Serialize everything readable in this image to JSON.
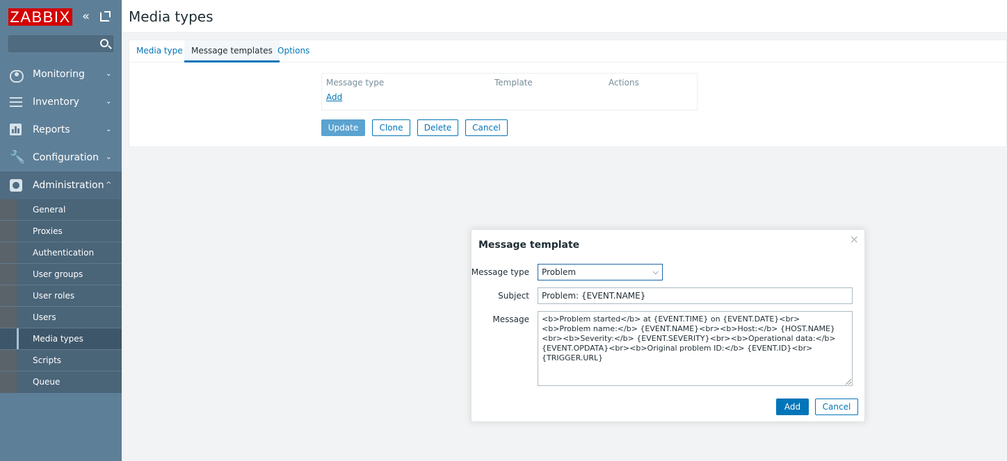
{
  "sidebar": {
    "logo": "ZABBIX",
    "search": {
      "value": "",
      "placeholder": ""
    },
    "menu": [
      {
        "label": "Monitoring",
        "icon": "eye-icon"
      },
      {
        "label": "Inventory",
        "icon": "list-icon"
      },
      {
        "label": "Reports",
        "icon": "bar-chart-icon"
      },
      {
        "label": "Configuration",
        "icon": "wrench-icon"
      },
      {
        "label": "Administration",
        "icon": "gear-icon"
      }
    ],
    "arrow_down": "⌄",
    "arrow_up": "^",
    "submenu": [
      {
        "label": "General"
      },
      {
        "label": "Proxies"
      },
      {
        "label": "Authentication"
      },
      {
        "label": "User groups"
      },
      {
        "label": "User roles"
      },
      {
        "label": "Users"
      },
      {
        "label": "Media types",
        "selected": true
      },
      {
        "label": "Scripts"
      },
      {
        "label": "Queue"
      }
    ]
  },
  "header": {
    "title": "Media types"
  },
  "tabs": [
    {
      "label": "Media type"
    },
    {
      "label": "Message templates",
      "active": true
    },
    {
      "label": "Options"
    }
  ],
  "templates_table": {
    "columns": [
      "Message type",
      "Template",
      "Actions"
    ],
    "add_label": "Add"
  },
  "form_buttons": {
    "update": "Update",
    "clone": "Clone",
    "delete": "Delete",
    "cancel": "Cancel"
  },
  "dialog": {
    "title": "Message template",
    "close": "×",
    "message_type_label": "Message type",
    "message_type_value": "Problem",
    "subject_label": "Subject",
    "subject_value": "Problem: {EVENT.NAME}",
    "message_label": "Message",
    "message_value": "<b>Problem started</b> at {EVENT.TIME} on {EVENT.DATE}<br><b>Problem name:</b> {EVENT.NAME}<br><b>Host:</b> {HOST.NAME}<br><b>Severity:</b> {EVENT.SEVERITY}<br><b>Operational data:</b> {EVENT.OPDATA}<br><b>Original problem ID:</b> {EVENT.ID}<br>{TRIGGER.URL}",
    "add_button": "Add",
    "cancel_button": "Cancel"
  },
  "colors": {
    "sidebar_bg": "#5e7f98",
    "logo_bg": "#d40000",
    "link": "#0275b8",
    "primary_button": "#5ba3d0",
    "dialog_add_button": "#0275b8"
  }
}
